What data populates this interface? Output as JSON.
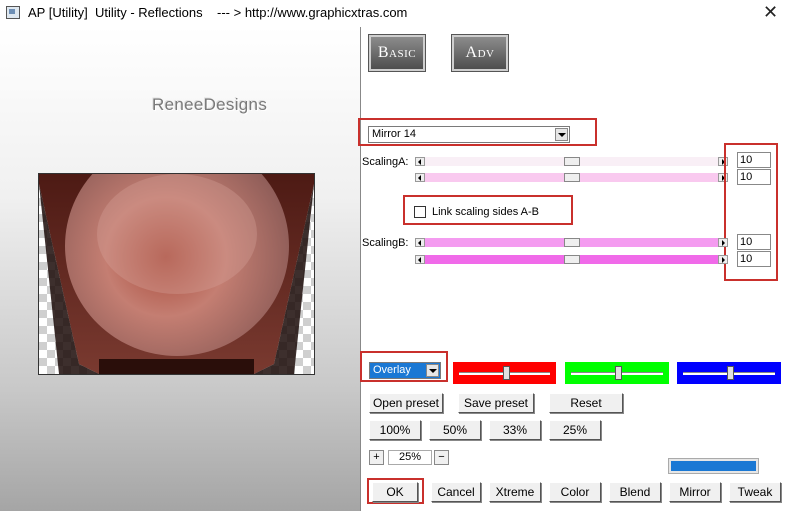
{
  "window": {
    "title": "AP [Utility]  Utility - Reflections    --- > http://www.graphicxtras.com",
    "close_glyph": "✕"
  },
  "preview": {
    "watermark": "ReneeDesigns"
  },
  "tabs": {
    "basic_label": "Basic",
    "adv_label": "Adv"
  },
  "effect_select": {
    "value": "Mirror 14"
  },
  "scaling_a": {
    "label": "ScalingA:",
    "slider1_value": "10",
    "slider2_value": "10",
    "slider1_position_percent": 50,
    "slider2_position_percent": 50,
    "track1_color": "#f9eff6",
    "track2_color": "#f9c9ef"
  },
  "link": {
    "label": "Link scaling sides A-B",
    "checked": false
  },
  "scaling_b": {
    "label": "ScalingB:",
    "slider1_value": "10",
    "slider2_value": "10",
    "slider1_position_percent": 50,
    "slider2_position_percent": 50,
    "track1_color": "#f49bf0",
    "track2_color": "#f06ae9"
  },
  "blend_select": {
    "value": "Overlay"
  },
  "color_sliders": [
    {
      "name": "red",
      "color": "#ff0000",
      "position_percent": 52
    },
    {
      "name": "green",
      "color": "#00ff00",
      "position_percent": 52
    },
    {
      "name": "blue",
      "color": "#0000ff",
      "position_percent": 52
    }
  ],
  "preset_buttons": {
    "open": "Open preset",
    "save": "Save preset",
    "reset": "Reset"
  },
  "zoom_buttons": {
    "z100": "100%",
    "z50": "50%",
    "z33": "33%",
    "z25": "25%"
  },
  "zoom": {
    "plus": "+",
    "value": "25%",
    "minus": "−"
  },
  "bottom_buttons": {
    "ok": "OK",
    "cancel": "Cancel",
    "xtreme": "Xtreme",
    "color": "Color",
    "blend": "Blend",
    "mirror": "Mirror",
    "tweak": "Tweak"
  },
  "colors": {
    "highlight_red": "#c9302c",
    "accent_blue": "#1a78d4"
  }
}
